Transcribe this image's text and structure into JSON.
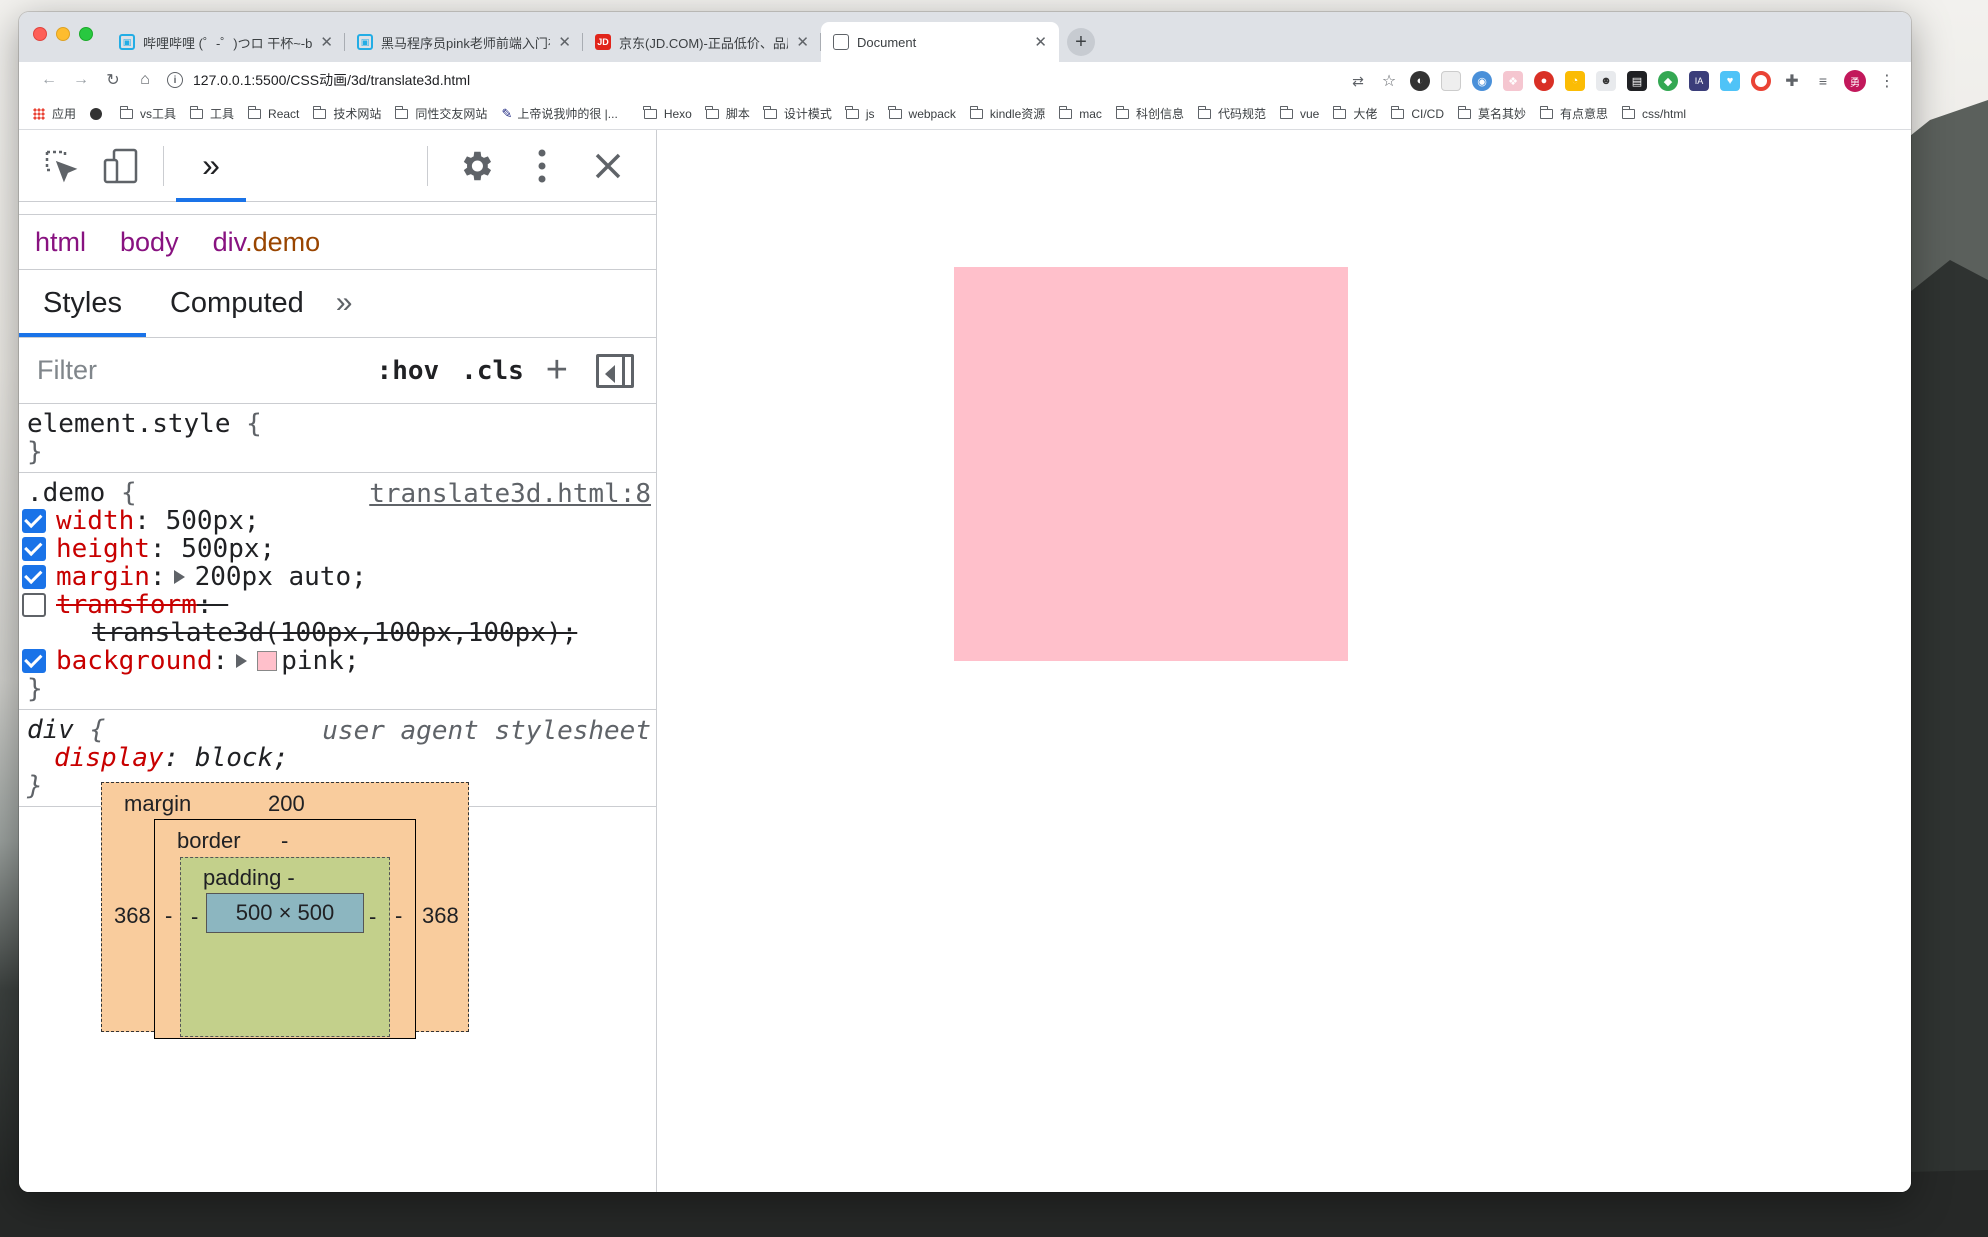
{
  "browser": {
    "tabs": [
      {
        "title": "哔哩哔哩 (゜-゜)つロ 干杯~-bili",
        "favicon": "bilibili-icon",
        "active": false
      },
      {
        "title": "黑马程序员pink老师前端入门视",
        "favicon": "bilibili-icon",
        "active": false
      },
      {
        "title": "京东(JD.COM)-正品低价、品质",
        "favicon": "jd-icon",
        "active": false
      },
      {
        "title": "Document",
        "favicon": "globe-icon",
        "active": true
      }
    ],
    "url": "127.0.0.1:5500/CSS动画/3d/translate3d.html",
    "avatar_text": "勇",
    "bookmarks": [
      "应用",
      "",
      "vs工具",
      "工具",
      "React",
      "技术网站",
      "同性交友网站",
      "上帝说我帅的很 |...",
      "Hexo",
      "脚本",
      "设计模式",
      "js",
      "webpack",
      "kindle资源",
      "mac",
      "科创信息",
      "代码规范",
      "vue",
      "大佬",
      "CI/CD",
      "莫名其妙",
      "有点意思",
      "css/html"
    ]
  },
  "devtools": {
    "breadcrumbs": {
      "html": "html",
      "body": "body",
      "div_tag": "div",
      "div_class": ".demo"
    },
    "subtabs": {
      "styles": "Styles",
      "computed": "Computed",
      "more": "»"
    },
    "filter": {
      "placeholder": "Filter",
      "hov": ":hov",
      "cls": ".cls",
      "add": "+"
    },
    "element_style": {
      "selector": "element.style",
      "open": "{",
      "close": "}"
    },
    "demo_rule": {
      "selector": ".demo",
      "open": "{",
      "close": "}",
      "source": "translate3d.html:8",
      "props": {
        "width": {
          "name": "width",
          "value": "500px;"
        },
        "height": {
          "name": "height",
          "value": "500px;"
        },
        "margin": {
          "name": "margin",
          "value": "200px auto;"
        },
        "transform": {
          "name": "transform",
          "value": "translate3d(100px,100px,100px);"
        },
        "background": {
          "name": "background",
          "value": "pink;"
        }
      }
    },
    "ua_rule": {
      "selector": "div",
      "open": "{",
      "close": "}",
      "source": "user agent stylesheet",
      "prop_name": "display",
      "prop_value": "block;"
    },
    "box_model": {
      "margin_label": "margin",
      "margin_top": "200",
      "margin_left": "368",
      "margin_right": "368",
      "border_label": "border",
      "border_top": "-",
      "border_left": "-",
      "border_right": "-",
      "padding_label": "padding -",
      "padding_left": "-",
      "padding_right": "-",
      "content": "500 × 500"
    }
  },
  "colors": {
    "demo_background": "#ffc0cb",
    "accent": "#1a73e8"
  }
}
